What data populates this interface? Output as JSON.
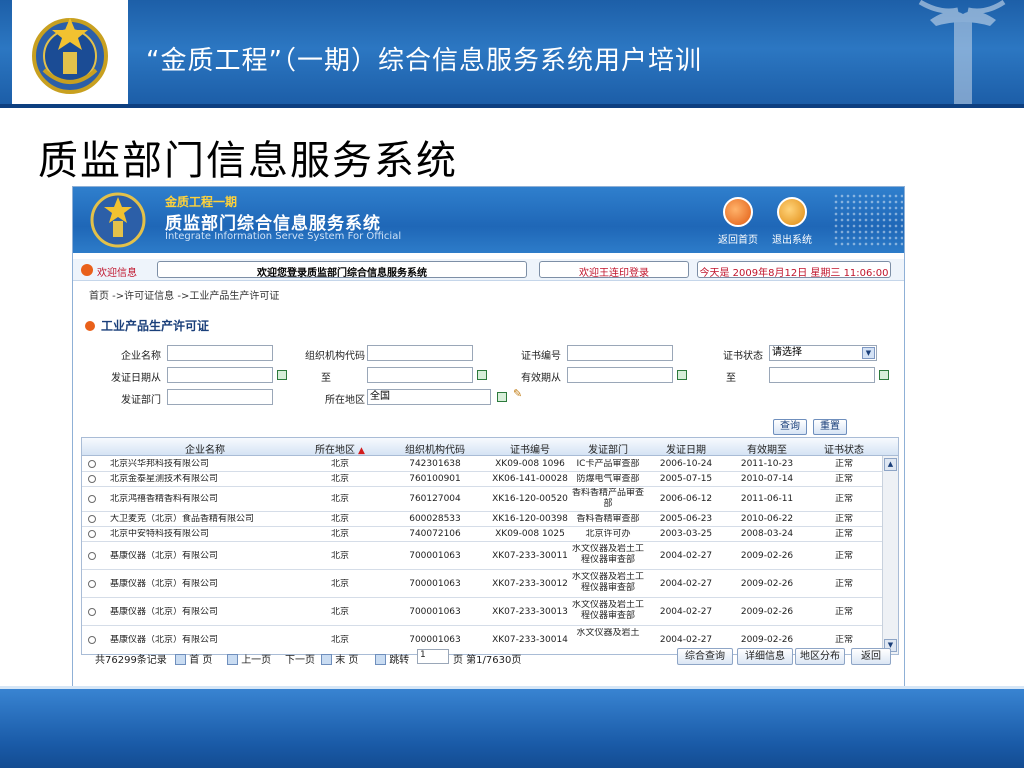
{
  "slide": {
    "header_title": "“金质工程”（一期）综合信息服务系统用户培训",
    "title": "质监部门信息服务系统"
  },
  "app": {
    "banner": {
      "subtitle": "金质工程一期",
      "name": "质监部门综合信息服务系统",
      "english": "Integrate Information Serve System For Official",
      "home_label": "返回首页",
      "exit_label": "退出系统"
    },
    "status": {
      "label": "欢迎信息",
      "welcome": "欢迎您登录质监部门综合信息服务系统",
      "user": "欢迎王连印登录",
      "date": "今天是 2009年8月12日 星期三 11:06:00"
    },
    "breadcrumb": "首页 ->许可证信息 ->工业产品生产许可证",
    "section_title": "工业产品生产许可证",
    "form": {
      "company_name_label": "企业名称",
      "org_code_label": "组织机构代码",
      "cert_no_label": "证书编号",
      "cert_status_label": "证书状态",
      "cert_status_value": "请选择",
      "issue_from_label": "发证日期从",
      "to_label": "至",
      "valid_from_label": "有效期从",
      "to_label2": "至",
      "issuing_dept_label": "发证部门",
      "region_label": "所在地区",
      "region_value": "全国"
    },
    "buttons": {
      "query": "查询",
      "reset": "重置"
    },
    "table": {
      "headers": [
        "企业名称",
        "所在地区",
        "组织机构代码",
        "证书编号",
        "发证部门",
        "发证日期",
        "有效期至",
        "证书状态"
      ],
      "rows": [
        [
          "北京兴华邦科技有限公司",
          "北京",
          "742301638",
          "XK09-008 1096",
          "IC卡产品审查部",
          "2006-10-24",
          "2011-10-23",
          "正常"
        ],
        [
          "北京金泰星测技术有限公司",
          "北京",
          "760100901",
          "XK06-141-00028",
          "防爆电气审查部",
          "2005-07-15",
          "2010-07-14",
          "正常"
        ],
        [
          "北京鸿禧香精香料有限公司",
          "北京",
          "760127004",
          "XK16-120-00520",
          "香料香精产品审查部",
          "2006-06-12",
          "2011-06-11",
          "正常"
        ],
        [
          "大卫麦克（北京）食品香精有限公司",
          "北京",
          "600028533",
          "XK16-120-00398",
          "香料香精审查部",
          "2005-06-23",
          "2010-06-22",
          "正常"
        ],
        [
          "北京中安特科技有限公司",
          "北京",
          "740072106",
          "XK09-008 1025",
          "北京许可办",
          "2003-03-25",
          "2008-03-24",
          "正常"
        ],
        [
          "基康仪器（北京）有限公司",
          "北京",
          "700001063",
          "XK07-233-30011",
          "水文仪器及岩土工程仪器审查部",
          "2004-02-27",
          "2009-02-26",
          "正常"
        ],
        [
          "基康仪器（北京）有限公司",
          "北京",
          "700001063",
          "XK07-233-30012",
          "水文仪器及岩土工程仪器审查部",
          "2004-02-27",
          "2009-02-26",
          "正常"
        ],
        [
          "基康仪器（北京）有限公司",
          "北京",
          "700001063",
          "XK07-233-30013",
          "水文仪器及岩土工程仪器审查部",
          "2004-02-27",
          "2009-02-26",
          "正常"
        ],
        [
          "基康仪器（北京）有限公司",
          "北京",
          "700001063",
          "XK07-233-30014",
          "水文仪器及岩土",
          "2004-02-27",
          "2009-02-26",
          "正常"
        ]
      ]
    },
    "pager": {
      "total": "共76299条记录",
      "first": "首 页",
      "prev": "上一页",
      "next": "下一页",
      "last": "末 页",
      "jump_label": "跳转",
      "jump_value": "1",
      "page_info": "页 第1/7630页",
      "btn_combined": "综合查询",
      "btn_detail": "详细信息",
      "btn_region": "地区分布",
      "btn_back": "返回"
    }
  }
}
